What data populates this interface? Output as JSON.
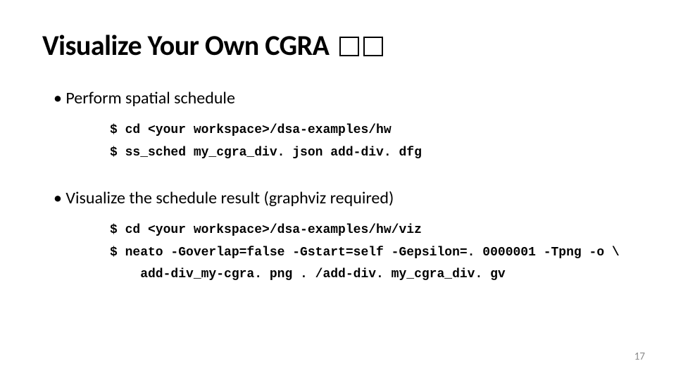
{
  "title": "Visualize Your Own CGRA ",
  "bullets": [
    {
      "text": "Perform spatial schedule",
      "commands": [
        "$ cd <your workspace>/dsa-examples/hw",
        "$ ss_sched my_cgra_div. json add-div. dfg"
      ]
    },
    {
      "text": "Visualize the schedule result (graphviz required)",
      "commands": [
        "$ cd <your workspace>/dsa-examples/hw/viz",
        "$ neato -Goverlap=false -Gstart=self -Gepsilon=. 0000001 -Tpng -o \\",
        "    add-div_my-cgra. png . /add-div. my_cgra_div. gv"
      ]
    }
  ],
  "page_number": "17"
}
